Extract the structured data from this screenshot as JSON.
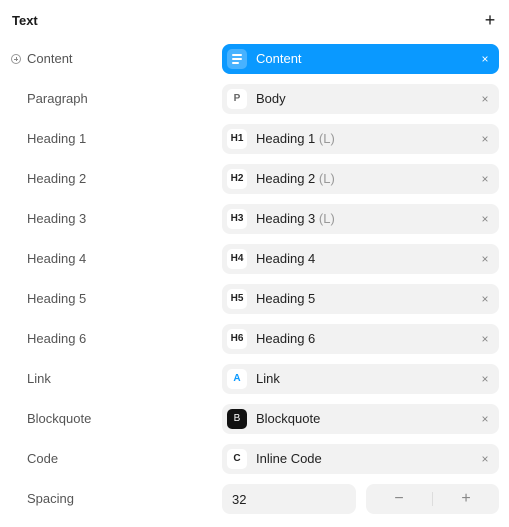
{
  "panel": {
    "title": "Text",
    "add_symbol": "+"
  },
  "rows": [
    {
      "label": "Content",
      "badge": "",
      "value": "Content",
      "suffix": "",
      "close": "×"
    },
    {
      "label": "Paragraph",
      "badge": "P",
      "value": "Body",
      "suffix": "",
      "close": "×"
    },
    {
      "label": "Heading 1",
      "badge": "H1",
      "value": "Heading 1",
      "suffix": "(L)",
      "close": "×"
    },
    {
      "label": "Heading 2",
      "badge": "H2",
      "value": "Heading 2",
      "suffix": "(L)",
      "close": "×"
    },
    {
      "label": "Heading 3",
      "badge": "H3",
      "value": "Heading 3",
      "suffix": "(L)",
      "close": "×"
    },
    {
      "label": "Heading 4",
      "badge": "H4",
      "value": "Heading 4",
      "suffix": "",
      "close": "×"
    },
    {
      "label": "Heading 5",
      "badge": "H5",
      "value": "Heading 5",
      "suffix": "",
      "close": "×"
    },
    {
      "label": "Heading 6",
      "badge": "H6",
      "value": "Heading 6",
      "suffix": "",
      "close": "×"
    },
    {
      "label": "Link",
      "badge": "A",
      "value": "Link",
      "suffix": "",
      "close": "×"
    },
    {
      "label": "Blockquote",
      "badge": "B",
      "value": "Blockquote",
      "suffix": "",
      "close": "×"
    },
    {
      "label": "Code",
      "badge": "C",
      "value": "Inline Code",
      "suffix": "",
      "close": "×"
    }
  ],
  "spacing": {
    "label": "Spacing",
    "value": "32",
    "minus": "−",
    "plus": "+"
  },
  "colors": {
    "accent": "#0a99ff",
    "field_bg": "#f2f2f2",
    "link_badge": "#0a99ff",
    "blockquote_badge": "#111111"
  }
}
